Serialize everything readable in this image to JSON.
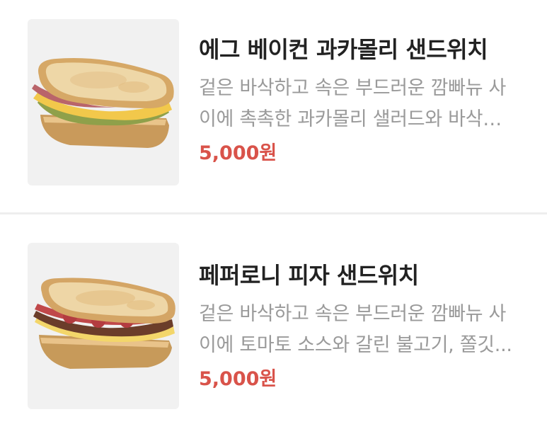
{
  "menu": {
    "items": [
      {
        "name": "에그 베이컨 과카몰리 샌드위치",
        "description": "겉은 바삭하고 속은 부드러운 깜빠뉴 사이에 촉촉한 과카몰리 샐러드와 바삭한...",
        "price": "5,000원",
        "image_icon": "egg-bacon-guacamole-sandwich-image"
      },
      {
        "name": "페퍼로니 피자 샌드위치",
        "description": "겉은 바삭하고 속은 부드러운 깜빠뉴 사이에 토마토 소스와 갈린 불고기, 쫄깃...",
        "price": "5,000원",
        "image_icon": "pepperoni-pizza-sandwich-image"
      }
    ]
  },
  "colors": {
    "price": "#d9534a",
    "title": "#222222",
    "description": "#9a9a9a",
    "thumb_bg": "#f1f1f1",
    "divider": "#eeeeee"
  }
}
